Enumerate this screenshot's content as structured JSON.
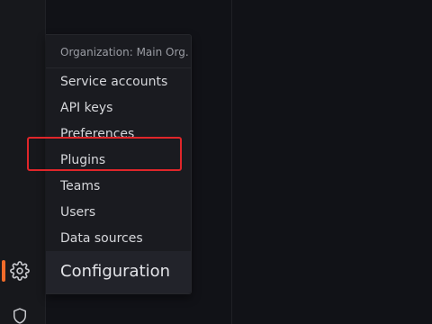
{
  "sidebar": {
    "icons": {
      "configuration": "gear-icon",
      "server_admin": "shield-icon"
    },
    "accent_color": "#f06b2a"
  },
  "config_menu": {
    "header": "Organization: Main Org.",
    "items": [
      {
        "label": "Service accounts"
      },
      {
        "label": "API keys"
      },
      {
        "label": "Preferences"
      },
      {
        "label": "Plugins"
      },
      {
        "label": "Teams"
      },
      {
        "label": "Users"
      },
      {
        "label": "Data sources"
      }
    ],
    "footer_label": "Configuration",
    "highlighted_item": "Plugins",
    "highlight_color": "#e0262a"
  }
}
